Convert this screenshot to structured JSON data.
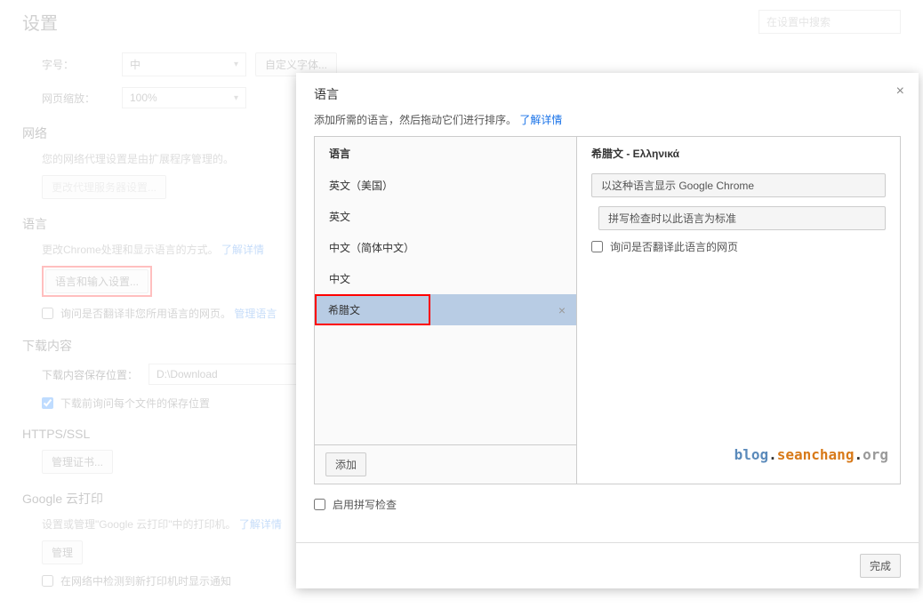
{
  "page": {
    "title": "设置",
    "search_placeholder": "在设置中搜索"
  },
  "font": {
    "label": "字号：",
    "value": "中",
    "custom_btn": "自定义字体..."
  },
  "zoom": {
    "label": "网页缩放：",
    "value": "100%"
  },
  "network": {
    "title": "网络",
    "desc": "您的网络代理设置是由扩展程序管理的。",
    "btn": "更改代理服务器设置..."
  },
  "language": {
    "title": "语言",
    "desc": "更改Chrome处理和显示语言的方式。",
    "learn": "了解详情",
    "btn": "语言和输入设置...",
    "checkbox_label": "询问是否翻译非您所用语言的网页。",
    "manage": "管理语言"
  },
  "downloads": {
    "title": "下载内容",
    "loc_label": "下载内容保存位置：",
    "loc_value": "D:\\Download",
    "ask_label": "下载前询问每个文件的保存位置"
  },
  "https": {
    "title": "HTTPS/SSL",
    "btn": "管理证书..."
  },
  "gcp": {
    "title": "Google 云打印",
    "desc": "设置或管理\"Google 云打印\"中的打印机。",
    "learn": "了解详情",
    "btn": "管理",
    "notify_label": "在网络中检测到新打印机时显示通知"
  },
  "dialog": {
    "title": "语言",
    "subtitle": "添加所需的语言，然后拖动它们进行排序。",
    "learn": "了解详情",
    "left_header": "语言",
    "items": [
      "英文（美国）",
      "英文",
      "中文（简体中文）",
      "中文",
      "希腊文"
    ],
    "add_btn": "添加",
    "right_title": "希腊文 - Ελληνικά",
    "display_btn": "以这种语言显示 Google Chrome",
    "spell_btn": "拼写检查时以此语言为标准",
    "translate_label": "询问是否翻译此语言的网页",
    "spell_check": "启用拼写检查",
    "done_btn": "完成"
  },
  "watermark": {
    "blog": "blog",
    "sean": "seanchang",
    "org": "org"
  }
}
